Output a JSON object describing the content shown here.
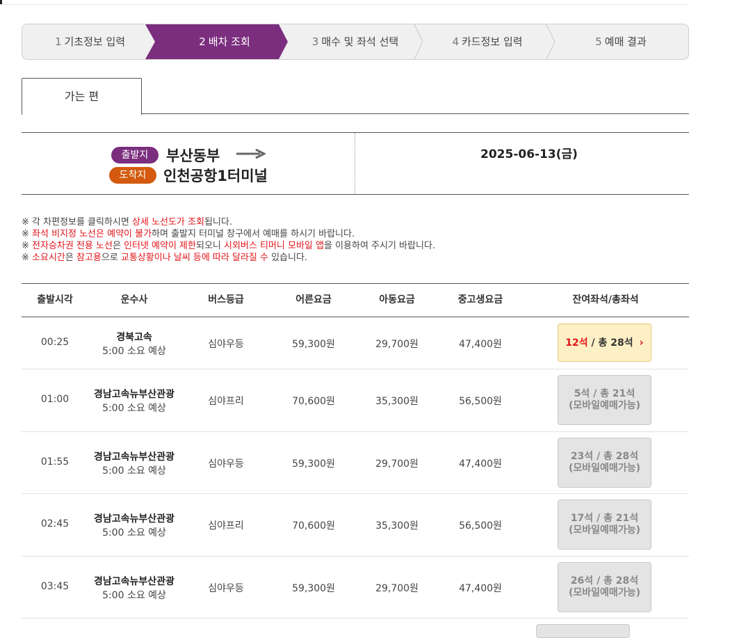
{
  "steps": [
    {
      "num": "1",
      "label": "기초정보 입력"
    },
    {
      "num": "2",
      "label": "배차 조회"
    },
    {
      "num": "3",
      "label": "매수 및 좌석 선택"
    },
    {
      "num": "4",
      "label": "카드정보 입력"
    },
    {
      "num": "5",
      "label": "예매 결과"
    }
  ],
  "active_step": 2,
  "tab": {
    "label": "가는 편"
  },
  "route": {
    "dep_badge": "출발지",
    "dep_place": "부산동부",
    "arr_badge": "도착지",
    "arr_place": "인천공항1터미널",
    "date": "2025-06-13(금)"
  },
  "notes": [
    [
      {
        "t": "※ 각 차편정보를 클릭하시면 "
      },
      {
        "t": "상세 노선도가 조회",
        "red": true
      },
      {
        "t": "됩니다."
      }
    ],
    [
      {
        "t": "※ "
      },
      {
        "t": "좌석 비지정 노선은 예약이 불가",
        "red": true
      },
      {
        "t": "하며 출발지 터미널 창구에서 예매를 하시기 바랍니다."
      }
    ],
    [
      {
        "t": "※ "
      },
      {
        "t": "전자승차권 전용 노선",
        "red": true
      },
      {
        "t": "은 "
      },
      {
        "t": "인터넷 예약이 제한",
        "red": true
      },
      {
        "t": "되오니 "
      },
      {
        "t": "시외버스 티머니 모바일 앱",
        "red": true
      },
      {
        "t": "을 이용하여 주시기 바랍니다."
      }
    ],
    [
      {
        "t": "※ "
      },
      {
        "t": "소요시간",
        "red": true
      },
      {
        "t": "은 "
      },
      {
        "t": "참고용",
        "red": true
      },
      {
        "t": "으로 "
      },
      {
        "t": "교통상황이나 날씨 등에 따라 달라질 수",
        "red": true
      },
      {
        "t": " 있습니다."
      }
    ]
  ],
  "table": {
    "headers": [
      "출발시각",
      "운수사",
      "버스등급",
      "어른요금",
      "아동요금",
      "중고생요금",
      "잔여좌석/총좌석"
    ],
    "rows": [
      {
        "time": "00:25",
        "company": "경북고속",
        "duration": "5:00 소요 예상",
        "grade": "심야우등",
        "adult": "59,300원",
        "child": "29,700원",
        "student": "47,400원",
        "seat": "12석",
        "total": "/ 총 28석",
        "mobile": "",
        "active": true
      },
      {
        "time": "01:00",
        "company": "경남고속뉴부산관광",
        "duration": "5:00 소요 예상",
        "grade": "심야프리",
        "adult": "70,600원",
        "child": "35,300원",
        "student": "56,500원",
        "seat": "5석",
        "total": "/ 총 21석",
        "mobile": "(모바일예매가능)",
        "active": false
      },
      {
        "time": "01:55",
        "company": "경남고속뉴부산관광",
        "duration": "5:00 소요 예상",
        "grade": "심야우등",
        "adult": "59,300원",
        "child": "29,700원",
        "student": "47,400원",
        "seat": "23석",
        "total": "/ 총 28석",
        "mobile": "(모바일예매가능)",
        "active": false
      },
      {
        "time": "02:45",
        "company": "경남고속뉴부산관광",
        "duration": "5:00 소요 예상",
        "grade": "심야프리",
        "adult": "70,600원",
        "child": "35,300원",
        "student": "56,500원",
        "seat": "17석",
        "total": "/ 총 21석",
        "mobile": "(모바일예매가능)",
        "active": false
      },
      {
        "time": "03:45",
        "company": "경남고속뉴부산관광",
        "duration": "5:00 소요 예상",
        "grade": "심야우등",
        "adult": "59,300원",
        "child": "29,700원",
        "student": "47,400원",
        "seat": "26석",
        "total": "/ 총 28석",
        "mobile": "(모바일예매가능)",
        "active": false
      }
    ]
  },
  "colors": {
    "accent_purple": "#7b2e7e",
    "accent_orange": "#d35a0e",
    "red": "#e2141a"
  }
}
